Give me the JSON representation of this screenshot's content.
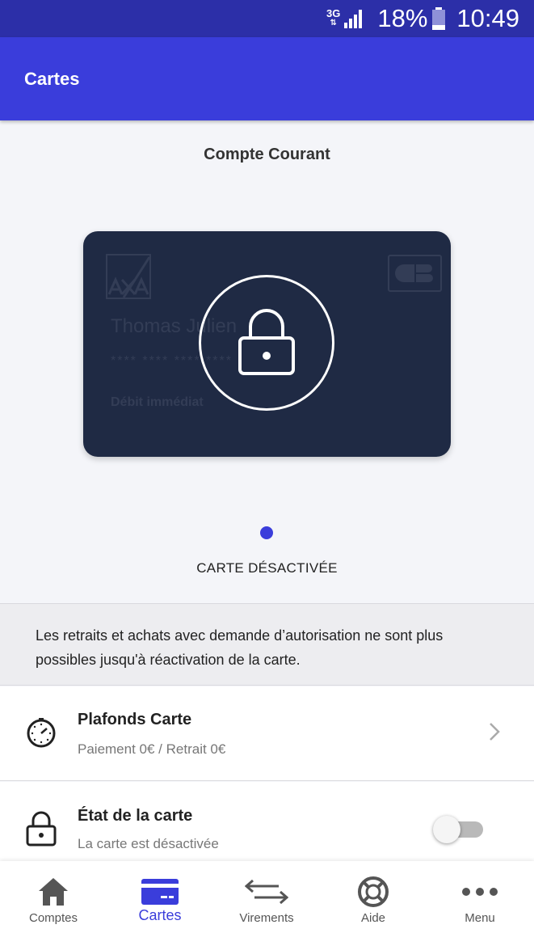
{
  "status_bar": {
    "network": "3G",
    "battery_percent": "18%",
    "time": "10:49"
  },
  "app_bar": {
    "title": "Cartes"
  },
  "account": {
    "name": "Compte Courant"
  },
  "card": {
    "brand_logo": "axa-logo",
    "network_logo": "cb-logo",
    "holder_name": "Thomas Julien",
    "masked_number": "**** **** **** ****",
    "card_type": "Débit immédiat",
    "locked": true
  },
  "card_status": "CARTE DÉSACTIVÉE",
  "info_banner": {
    "line1": "Les retraits et achats avec demande d’autorisation ne sont plus",
    "line2": "possibles jusqu'à réactivation de la carte."
  },
  "limits_row": {
    "title": "Plafonds Carte",
    "subtitle": "Paiement 0€ / Retrait 0€",
    "icon": "clock-icon"
  },
  "state_row": {
    "title": "État de la carte",
    "subtitle": "La carte est désactivée",
    "icon": "lock-icon",
    "toggle_on": false
  },
  "bottom_nav": {
    "items": [
      {
        "label": "Comptes",
        "icon": "home-icon",
        "active": false
      },
      {
        "label": "Cartes",
        "icon": "card-icon",
        "active": true
      },
      {
        "label": "Virements",
        "icon": "transfer-icon",
        "active": false
      },
      {
        "label": "Aide",
        "icon": "lifebuoy-icon",
        "active": false
      },
      {
        "label": "Menu",
        "icon": "more-icon",
        "active": false
      }
    ]
  },
  "colors": {
    "primary": "#3a3ddb",
    "status_bar": "#2c2fa8",
    "card_background": "#1f2a44"
  }
}
